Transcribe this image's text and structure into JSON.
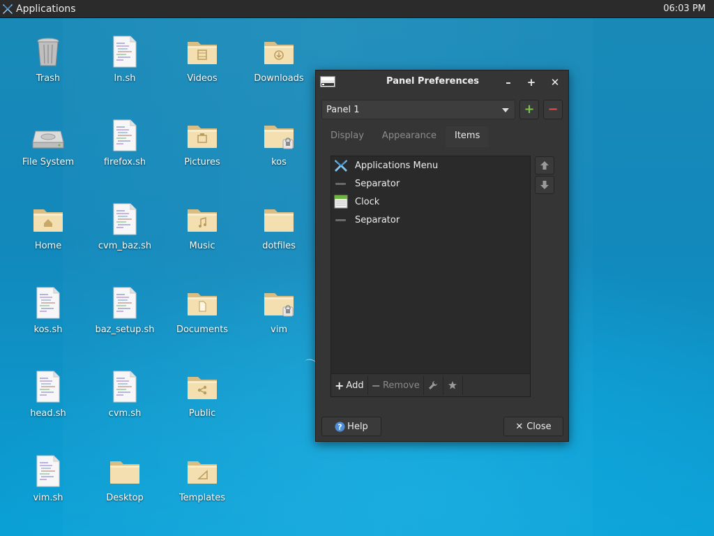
{
  "top_panel": {
    "applications_label": "Applications",
    "clock": "06:03 PM"
  },
  "desktop": {
    "icons": [
      {
        "label": "Trash",
        "icon": "trash-icon"
      },
      {
        "label": "ln.sh",
        "icon": "script-file-icon"
      },
      {
        "label": "Videos",
        "icon": "videos-folder-icon"
      },
      {
        "label": "Downloads",
        "icon": "downloads-folder-icon"
      },
      {
        "label": "File System",
        "icon": "drive-icon"
      },
      {
        "label": "firefox.sh",
        "icon": "script-file-icon"
      },
      {
        "label": "Pictures",
        "icon": "pictures-folder-icon"
      },
      {
        "label": "kos",
        "icon": "locked-folder-icon"
      },
      {
        "label": "Home",
        "icon": "home-folder-icon"
      },
      {
        "label": "cvm_baz.sh",
        "icon": "script-file-icon"
      },
      {
        "label": "Music",
        "icon": "music-folder-icon"
      },
      {
        "label": "dotfiles",
        "icon": "folder-icon"
      },
      {
        "label": "kos.sh",
        "icon": "script-file-icon"
      },
      {
        "label": "baz_setup.sh",
        "icon": "script-file-icon"
      },
      {
        "label": "Documents",
        "icon": "documents-folder-icon"
      },
      {
        "label": "vim",
        "icon": "locked-folder-icon"
      },
      {
        "label": "head.sh",
        "icon": "script-file-icon"
      },
      {
        "label": "cvm.sh",
        "icon": "script-file-icon"
      },
      {
        "label": "Public",
        "icon": "public-folder-icon"
      },
      {
        "label": "vim.sh",
        "icon": "script-file-icon"
      },
      {
        "label": "Desktop",
        "icon": "folder-icon"
      },
      {
        "label": "Templates",
        "icon": "templates-folder-icon"
      }
    ]
  },
  "dialog": {
    "title": "Panel Preferences",
    "panel_select": "Panel 1",
    "tabs": [
      {
        "label": "Display",
        "active": false
      },
      {
        "label": "Appearance",
        "active": false
      },
      {
        "label": "Items",
        "active": true
      }
    ],
    "items": [
      {
        "label": "Applications Menu",
        "icon": "xfce-logo-icon"
      },
      {
        "label": "Separator",
        "icon": "separator-icon"
      },
      {
        "label": "Clock",
        "icon": "clock-icon"
      },
      {
        "label": "Separator",
        "icon": "separator-icon"
      }
    ],
    "add_label": "Add",
    "remove_label": "Remove",
    "help_label": "Help",
    "close_label": "Close"
  },
  "colors": {
    "add_green": "#7ec44a",
    "remove_red": "#e05252",
    "help_blue": "#4a8fd8",
    "folder": "#f0dcab"
  }
}
